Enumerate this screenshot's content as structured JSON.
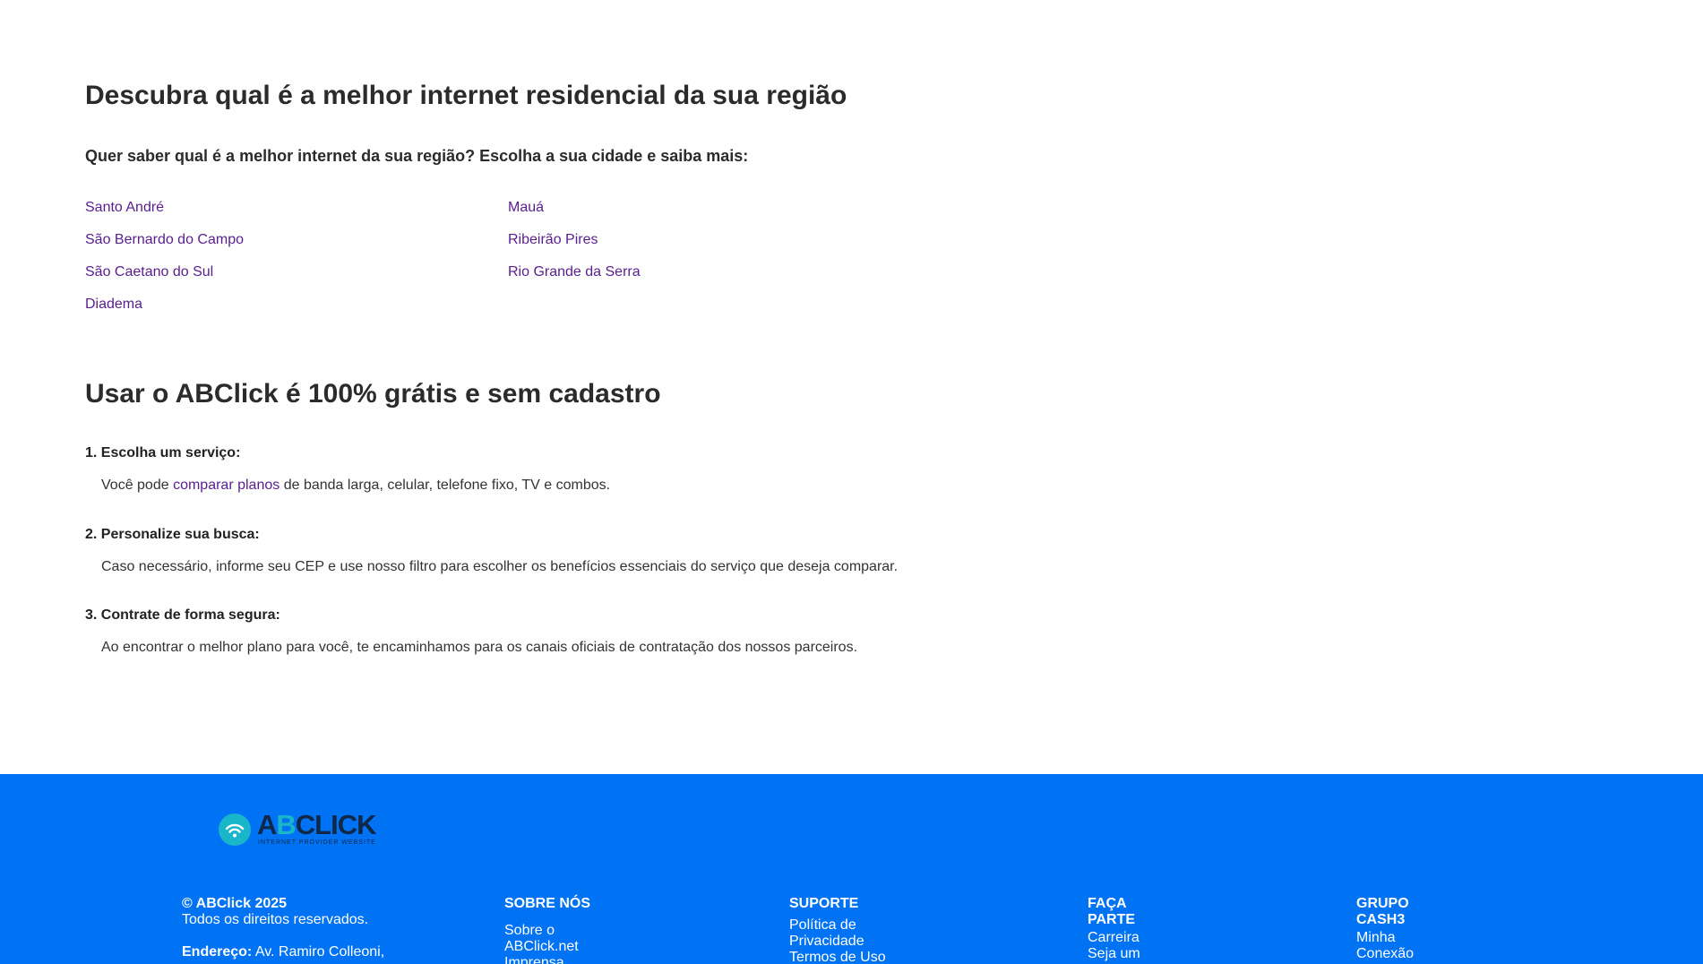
{
  "region": {
    "title": "Descubra qual é a melhor internet residencial da sua região",
    "subtitle": "Quer saber qual é a melhor internet da sua região? Escolha a sua cidade e saiba mais:",
    "cities_left": [
      "Santo André",
      "São Bernardo do Campo",
      "São Caetano do Sul",
      "Diadema"
    ],
    "cities_right": [
      "Mauá",
      "Ribeirão Pires",
      "Rio Grande da Serra"
    ]
  },
  "free": {
    "title": "Usar o ABClick é 100% grátis e sem cadastro",
    "steps": [
      {
        "title": "1. Escolha um serviço:",
        "text_before": "Você pode ",
        "link": "comparar planos",
        "text_after": " de banda larga, celular, telefone fixo, TV e combos."
      },
      {
        "title": "2. Personalize sua busca:",
        "text": "Caso necessário, informe seu CEP e use nosso filtro para escolher os benefícios essenciais do serviço que deseja comparar."
      },
      {
        "title": "3. Contrate de forma segura:",
        "text": "Ao encontrar o melhor plano para você, te encaminhamos para os canais oficiais de contratação dos nossos parceiros."
      }
    ]
  },
  "footer": {
    "logo": {
      "part1": "A",
      "part2": "B",
      "part3": "CLICK",
      "tagline": "INTERNET PROVIDER WEBSITE"
    },
    "copyright": "© ABClick 2025",
    "rights": "Todos os direitos reservados.",
    "address_label": "Endereço:",
    "address_value": " Av. Ramiro Colleoni,",
    "about": {
      "heading": "SOBRE NÓS",
      "links": [
        "Sobre o ABClick.net",
        "Imprensa"
      ]
    },
    "support": {
      "heading": "SUPORTE",
      "links": [
        "Política de Privacidade",
        "Termos de Uso"
      ]
    },
    "join": {
      "heading": "FAÇA PARTE",
      "links": [
        "Carreira",
        "Seja um"
      ]
    },
    "group": {
      "heading": "GRUPO CASH3",
      "links": [
        "Minha Conexão"
      ]
    },
    "colors": {
      "background": "#0073f5",
      "logo_accent": "#19b5c9",
      "logo_dark": "#0f2847",
      "link": "#5a1d8f"
    }
  }
}
